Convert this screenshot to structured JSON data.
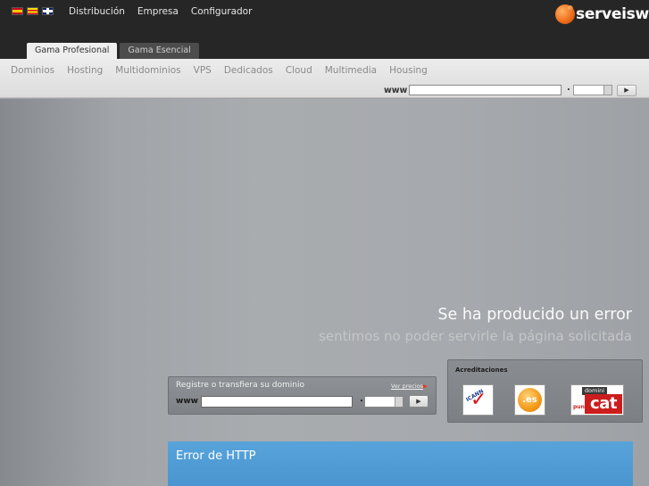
{
  "header": {
    "languages": [
      "es",
      "ca",
      "en"
    ],
    "nav": [
      "Distribución",
      "Empresa",
      "Configurador"
    ],
    "logo": "serveisweb",
    "accent_color": "#f0701a"
  },
  "tabs": [
    "Gama Profesional",
    "Gama Esencial"
  ],
  "active_tab": 0,
  "categories": [
    "Dominios",
    "Hosting",
    "Multidominios",
    "VPS",
    "Dedicados",
    "Cloud",
    "Multimedia",
    "Housing"
  ],
  "domain_search": {
    "www_label": "www",
    "dot": ".",
    "domain_value": "",
    "tld_value": ""
  },
  "error": {
    "title": "Se ha producido un error",
    "subtitle": "sentimos no poder servirle la página solicitada"
  },
  "register": {
    "title": "Registre o transfiera su dominio",
    "prices_link": "Ver precios",
    "www_label": "www",
    "dot": "."
  },
  "accreditations": {
    "title": "Acreditaciones",
    "badges": [
      "ICANN",
      ".es",
      "domini punt cat"
    ],
    "icann_text": "ICANN",
    "es_text": ".es",
    "cat_domini": "domini",
    "cat_punt": "punt",
    "cat_cat": "cat"
  },
  "http_panel": {
    "title": "Error de HTTP",
    "color": "#4a95cf"
  }
}
